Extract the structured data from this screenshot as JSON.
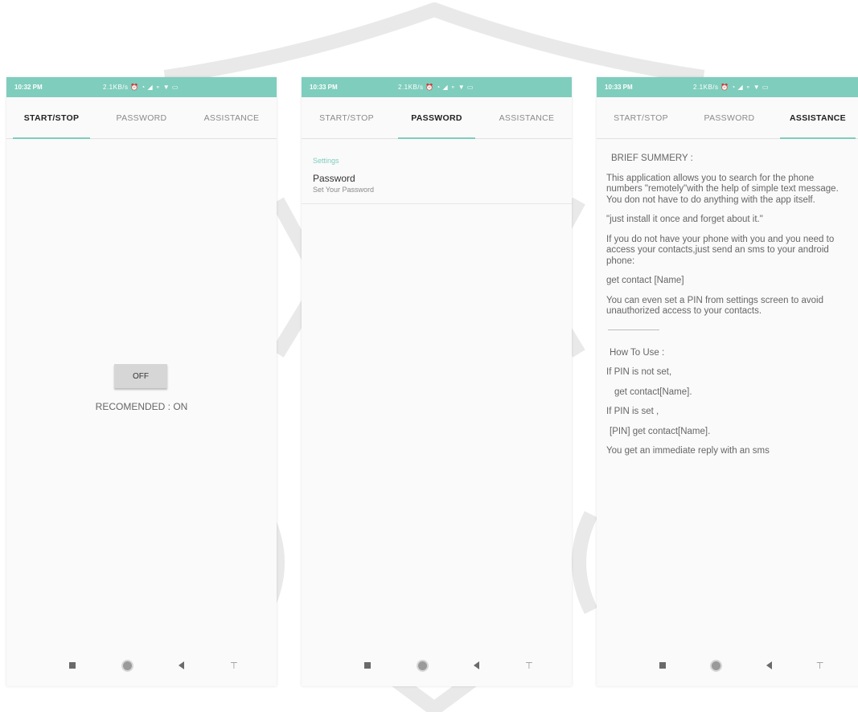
{
  "status_bar": {
    "phone1": {
      "time": "10:32 PM",
      "icons": "2.1KB/s ⏰ ◔ ◢ ⚬ ▼ ▭"
    },
    "phone2": {
      "time": "10:33 PM",
      "icons": "2.1KB/s ⏰ ◔ ◢ ⚬ ▼ ▭"
    },
    "phone3": {
      "time": "10:33 PM",
      "icons": "2.1KB/s ⏰ ◔ ◢ ⚬ ▼ ▭"
    }
  },
  "tabs": {
    "start_stop": "START/STOP",
    "password": "PASSWORD",
    "assistance": "ASSISTANCE"
  },
  "start_stop": {
    "toggle_label": "OFF",
    "recommended": "RECOMENDED : ON"
  },
  "password": {
    "section_header": "Settings",
    "item_title": "Password",
    "item_summary": "Set Your Password"
  },
  "assistance": {
    "heading": "BRIEF SUMMERY :",
    "p1": "This application allows you to search for the phone numbers \"remotely\"with the help of simple text message.",
    "p2": "You don not have to do anything with the app itself.",
    "p3": "\"just install it once and forget about it.\"",
    "p4": "If you do not have your phone with you and you need to access your contacts,just send an sms to your android phone:",
    "p5": "get contact [Name]",
    "p6": "You can even set a PIN from settings screen to avoid unauthorized access to your contacts.",
    "how_to_use": "How To Use :",
    "p7": "If PIN is not set,",
    "p8": "get contact[Name].",
    "p9": "If PIN is set ,",
    "p10": "[PIN] get contact[Name].",
    "p11": "You get an immediate reply with an sms"
  },
  "colors": {
    "accent": "#7fcdbd",
    "watermark": "#c9c9c9"
  }
}
